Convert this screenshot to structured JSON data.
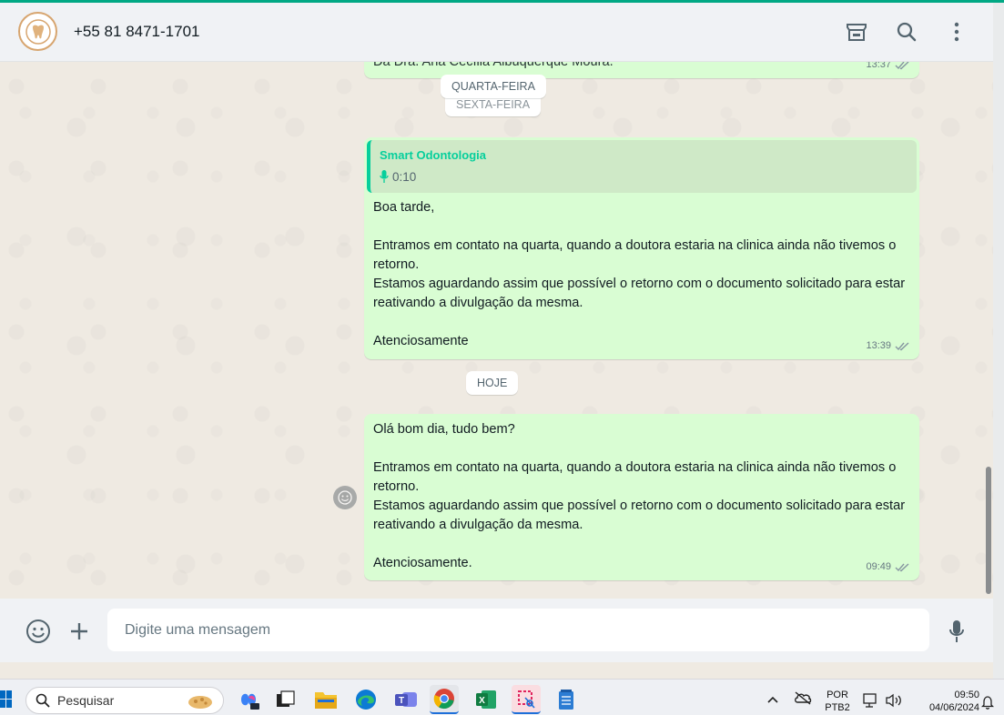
{
  "header": {
    "contact_name": "+55 81 8471-1701"
  },
  "chat": {
    "prev_message_fragment": "Da Dra. Ana Cecília Albuquerque Moura.",
    "prev_message_time": "13:37",
    "date_chips": {
      "wednesday": "QUARTA-FEIRA",
      "friday": "SEXTA-FEIRA",
      "today": "HOJE"
    },
    "message1": {
      "quote_author": "Smart Odontologia",
      "quote_audio_duration": "0:10",
      "text": "Boa tarde,\n\nEntramos em contato na quarta, quando a doutora estaria na clinica ainda não tivemos o retorno.\nEstamos aguardando assim que possível o retorno com o documento solicitado para estar reativando a divulgação da mesma.\n\nAtenciosamente",
      "time": "13:39"
    },
    "message2": {
      "text": "Olá bom dia, tudo bem?\n\nEntramos em contato na quarta, quando a doutora estaria na clinica ainda não tivemos o retorno.\nEstamos aguardando assim que possível o retorno com o documento solicitado para estar reativando a divulgação da mesma.\n\nAtenciosamente.",
      "time": "09:49"
    }
  },
  "footer": {
    "input_placeholder": "Digite uma mensagem",
    "input_value": ""
  },
  "taskbar": {
    "search_label": "Pesquisar",
    "lang_line1": "POR",
    "lang_line2": "PTB2",
    "time": "09:50",
    "date": "04/06/2024"
  },
  "colors": {
    "accent": "#00a884",
    "outgoing_bubble": "#d9fdd3",
    "quote_author": "#06cf9c"
  }
}
